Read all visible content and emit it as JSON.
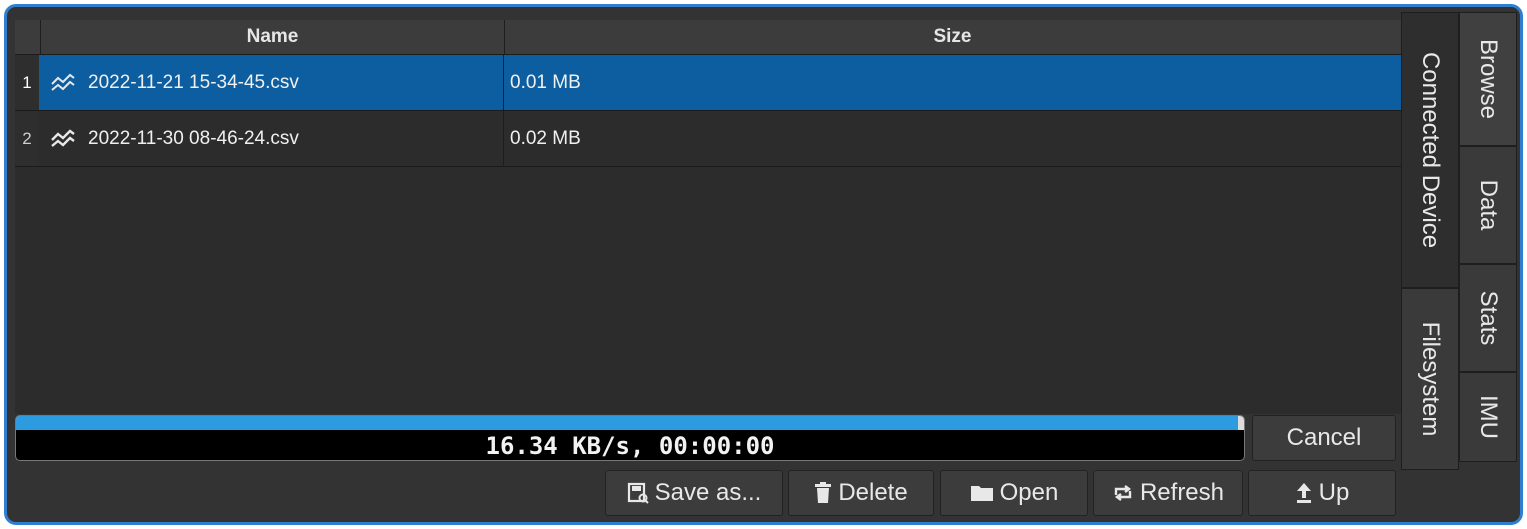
{
  "table": {
    "headers": {
      "name": "Name",
      "size": "Size"
    },
    "rows": [
      {
        "num": "1",
        "name": "2022-11-21 15-34-45.csv",
        "size": "0.01 MB",
        "selected": true
      },
      {
        "num": "2",
        "name": "2022-11-30 08-46-24.csv",
        "size": "0.02 MB",
        "selected": false
      }
    ]
  },
  "progress": {
    "text": "16.34 KB/s, 00:00:00",
    "fraction": 0.995
  },
  "buttons": {
    "cancel": "Cancel",
    "save_as": "Save as...",
    "delete": "Delete",
    "open": "Open",
    "refresh": "Refresh",
    "up": "Up"
  },
  "inner_tabs": {
    "connected_device": "Connected Device",
    "filesystem": "Filesystem"
  },
  "outer_tabs": {
    "browse": "Browse",
    "data": "Data",
    "stats": "Stats",
    "imu": "IMU"
  },
  "colors": {
    "selection": "#0d5ea0",
    "progress_fill": "#2d9bdf",
    "frame_border": "#2f7fce"
  }
}
